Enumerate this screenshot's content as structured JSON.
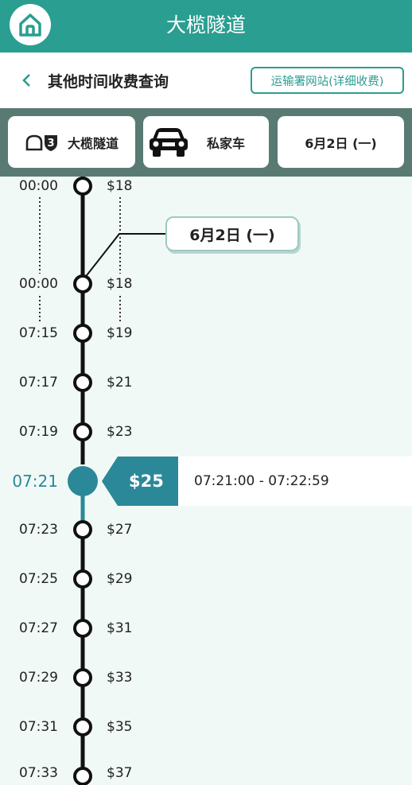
{
  "header": {
    "title": "大榄隧道",
    "home_icon": "home-icon"
  },
  "subheader": {
    "title": "其他时间收费查询",
    "td_link_label": "运输署网站(详细收费)"
  },
  "filters": {
    "tunnel": "大榄隧道",
    "tunnel_route_number": "3",
    "vehicle": "私家车",
    "date": "6月2日 (一)"
  },
  "timeline": {
    "date_marker": "6月2日 (一)",
    "rows": [
      {
        "time": "00:00",
        "price": "$18"
      },
      {
        "time": "00:00",
        "price": "$18"
      },
      {
        "time": "07:15",
        "price": "$19"
      },
      {
        "time": "07:17",
        "price": "$21"
      },
      {
        "time": "07:19",
        "price": "$23"
      },
      {
        "time": "07:23",
        "price": "$27"
      },
      {
        "time": "07:25",
        "price": "$29"
      },
      {
        "time": "07:27",
        "price": "$31"
      },
      {
        "time": "07:29",
        "price": "$33"
      },
      {
        "time": "07:31",
        "price": "$35"
      },
      {
        "time": "07:33",
        "price": "$37"
      }
    ],
    "selected": {
      "time": "07:21",
      "price": "$25",
      "range": "07:21:00 - 07:22:59"
    }
  },
  "colors": {
    "primary": "#2a9e91",
    "filter_bg": "#587a73",
    "selected": "#2a8899",
    "page_bg": "#f1f9f6"
  }
}
